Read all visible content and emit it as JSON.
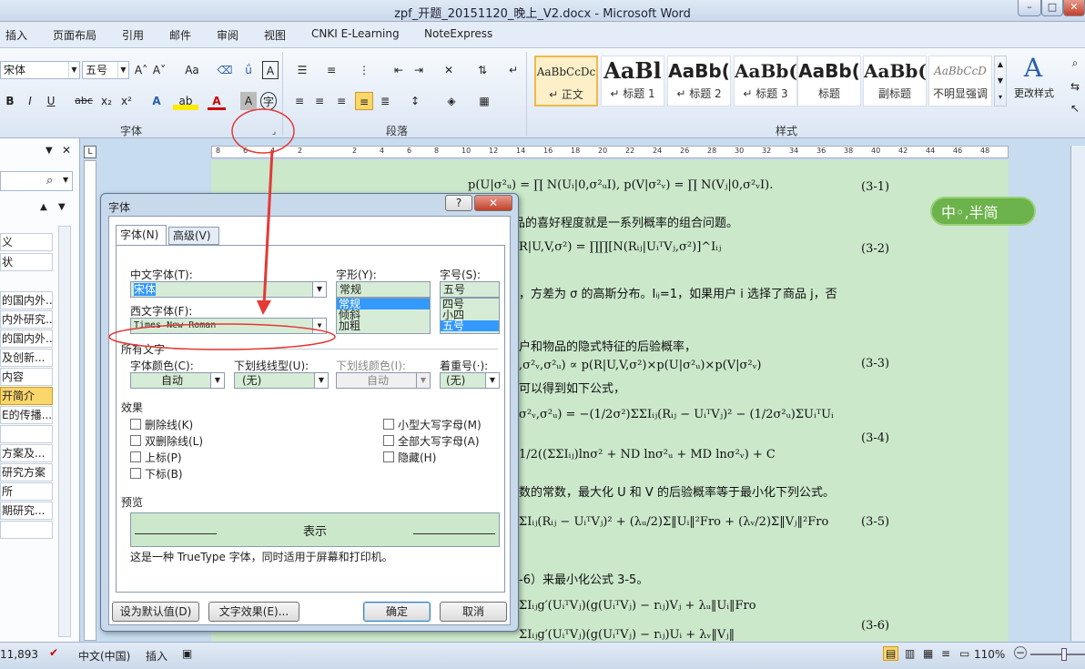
{
  "window": {
    "title": "zpf_开题_20151120_晚上_V2.docx - Microsoft Word",
    "min": "–",
    "max": "□",
    "close": "✕"
  },
  "menu_tabs": [
    "插入",
    "页面布局",
    "引用",
    "邮件",
    "审阅",
    "视图",
    "CNKI E-Learning",
    "NoteExpress"
  ],
  "ribbon": {
    "font_name": "宋体",
    "font_size": "五号",
    "font_group_label": "字体",
    "paragraph_group_label": "段落",
    "styles_group_label": "样式",
    "bold": "B",
    "italic": "I",
    "underline": "U",
    "strike": "abc",
    "subscript": "x₂",
    "superscript": "x²",
    "grow": "A˄",
    "shrink": "A˅",
    "case": "Aa",
    "clear": "A",
    "change_styles": "更改样式",
    "styles": [
      {
        "preview": "AaBbCcDc",
        "label": "↵ 正文"
      },
      {
        "preview": "AaBl",
        "label": "↵ 标题 1"
      },
      {
        "preview": "AaBb(",
        "label": "↵ 标题 2"
      },
      {
        "preview": "AaBb(",
        "label": "↵ 标题 3"
      },
      {
        "preview": "AaBb(",
        "label": "标题"
      },
      {
        "preview": "AaBb(",
        "label": "副标题"
      },
      {
        "preview": "AaBbCcD",
        "label": "不明显强调"
      }
    ]
  },
  "nav": {
    "items": [
      "义",
      "状",
      "的国内外...",
      "内外研究...",
      "的国内外...",
      "及创新...",
      "内容",
      "开简介",
      "E的传播...",
      "",
      "方案及...",
      "研究方案",
      "所",
      "期研究...",
      ""
    ]
  },
  "ruler": {
    "ticks": [
      "8",
      "6",
      "4",
      "2",
      "",
      "2",
      "4",
      "6",
      "8",
      "10",
      "12",
      "14",
      "16",
      "18",
      "20",
      "22",
      "24",
      "26",
      "28",
      "30",
      "32",
      "34",
      "36",
      "38",
      "40",
      "42",
      "44",
      "46",
      "48"
    ]
  },
  "document": {
    "lines": [
      "p(U|σ²ᵤ) = ∏ N(Uᵢ|0,σ²ᵤI), p(V|σ²ᵥ) = ∏ N(Vⱼ|0,σ²ᵥI).",
      "品的喜好程度就是一系列概率的组合问题。",
      "R|U,V,σ²) = ∏∏[N(Rᵢⱼ|UᵢᵀVⱼ,σ²)]^Iᵢⱼ",
      "，方差为 σ 的高斯分布。Iᵢⱼ=1，如果用户 i 选择了商品 j，否",
      "户和物品的隐式特征的后验概率，",
      ",σ²ᵥ,σ²ᵤ) ∝ p(R|U,V,σ²)×p(U|σ²ᵤ)×p(V|σ²ᵥ)",
      "可以得到如下公式，",
      "σ²ᵥ,σ²ᵤ) = −(1/2σ²)ΣΣIᵢⱼ(Rᵢⱼ − UᵢᵀVⱼ)² − (1/2σ²ᵤ)ΣUᵢᵀUᵢ",
      "1/2((ΣΣIᵢⱼ)lnσ² + ND lnσ²ᵤ + MD lnσ²ᵥ) + C",
      "数的常数，最大化 U 和 V 的后验概率等于最小化下列公式。",
      "ΣIᵢⱼ(Rᵢⱼ − UᵢᵀVⱼ)² + (λᵤ/2)Σ‖Uᵢ‖²Fro + (λᵥ/2)Σ‖Vⱼ‖²Fro",
      "-6）来最小化公式 3-5。",
      "ΣIᵢⱼg′(UᵢᵀVⱼ)(g(UᵢᵀVⱼ) − rᵢⱼ)Vⱼ + λᵤ‖Uᵢ‖Fro",
      "ΣIᵢⱼg′(UᵢᵀVⱼ)(g(UᵢᵀVⱼ) − rᵢⱼ)Uᵢ + λᵥ‖Vⱼ‖"
    ],
    "eq_numbers": [
      "(3-1)",
      "(3-2)",
      "(3-3)",
      "(3-4)",
      "(3-5)",
      "(3-6)"
    ],
    "ime_badge": "中◦,半简"
  },
  "dialog": {
    "title": "字体",
    "help": "?",
    "close": "✕",
    "tab_font": "字体(N)",
    "tab_advanced": "高级(V)",
    "cn_font_label": "中文字体(T):",
    "cn_font_value": "宋体",
    "west_font_label": "西文字体(F):",
    "west_font_value": "Times New Roman",
    "style_label": "字形(Y):",
    "style_value": "常规",
    "style_options": [
      "常规",
      "倾斜",
      "加粗"
    ],
    "size_label": "字号(S):",
    "size_value": "五号",
    "size_options": [
      "四号",
      "小四",
      "五号"
    ],
    "all_text_label": "所有文字",
    "color_label": "字体颜色(C):",
    "color_value": "自动",
    "underline_label": "下划线线型(U):",
    "underline_value": "(无)",
    "underline_color_label": "下划线颜色(I):",
    "underline_color_value": "自动",
    "emphasis_label": "着重号(·):",
    "emphasis_value": "(无)",
    "effects_label": "效果",
    "effects_left": [
      "删除线(K)",
      "双删除线(L)",
      "上标(P)",
      "下标(B)"
    ],
    "effects_right": [
      "小型大写字母(M)",
      "全部大写字母(A)",
      "隐藏(H)"
    ],
    "preview_label": "预览",
    "preview_text": "表示",
    "preview_note": "这是一种 TrueType 字体，同时适用于屏幕和打印机。",
    "set_default": "设为默认值(D)",
    "text_effects": "文字效果(E)...",
    "ok": "确定",
    "cancel": "取消"
  },
  "status": {
    "words": "11,893",
    "language": "中文(中国)",
    "insert_mode": "插入",
    "zoom": "110%",
    "zoom_minus": "−",
    "zoom_plus": "+"
  },
  "colors": {
    "accent": "#3399ff",
    "annotation": "#e53935",
    "doc_bg": "#cbe8cb",
    "ribbon": "#dbe6f4"
  }
}
